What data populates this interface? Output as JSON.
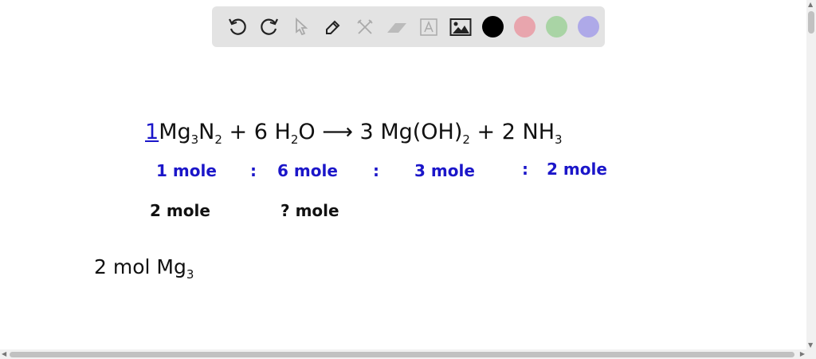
{
  "toolbar": {
    "tools": [
      "undo-icon",
      "redo-icon",
      "select-icon",
      "pen-icon",
      "tools-icon",
      "eraser-icon",
      "text-icon",
      "image-icon"
    ],
    "colors": [
      "#000000",
      "#e8a5ad",
      "#a9d4a5",
      "#aea9e8"
    ]
  },
  "canvas": {
    "equation": {
      "coef1": "1",
      "r1": "Mg",
      "r1s1": "3",
      "r1b": "N",
      "r1s2": "2",
      "plus1": "+",
      "coef2": "6",
      "r2": "H",
      "r2s": "2",
      "r2b": "O",
      "arrow": "⟶",
      "coef3": "3",
      "p1": "Mg(OH)",
      "p1s": "2",
      "plus2": "+",
      "coef4": "2",
      "p2": "NH",
      "p2s": "3"
    },
    "ratio": {
      "a": "1 mole",
      "sep1": ":",
      "b": "6 mole",
      "sep2": ":",
      "c": "3 mole",
      "sep3": ":",
      "d": "2 mole"
    },
    "given": {
      "a": "2 mole",
      "b": "? mole"
    },
    "line3": "2 mol Mg",
    "line3sub": "3"
  }
}
